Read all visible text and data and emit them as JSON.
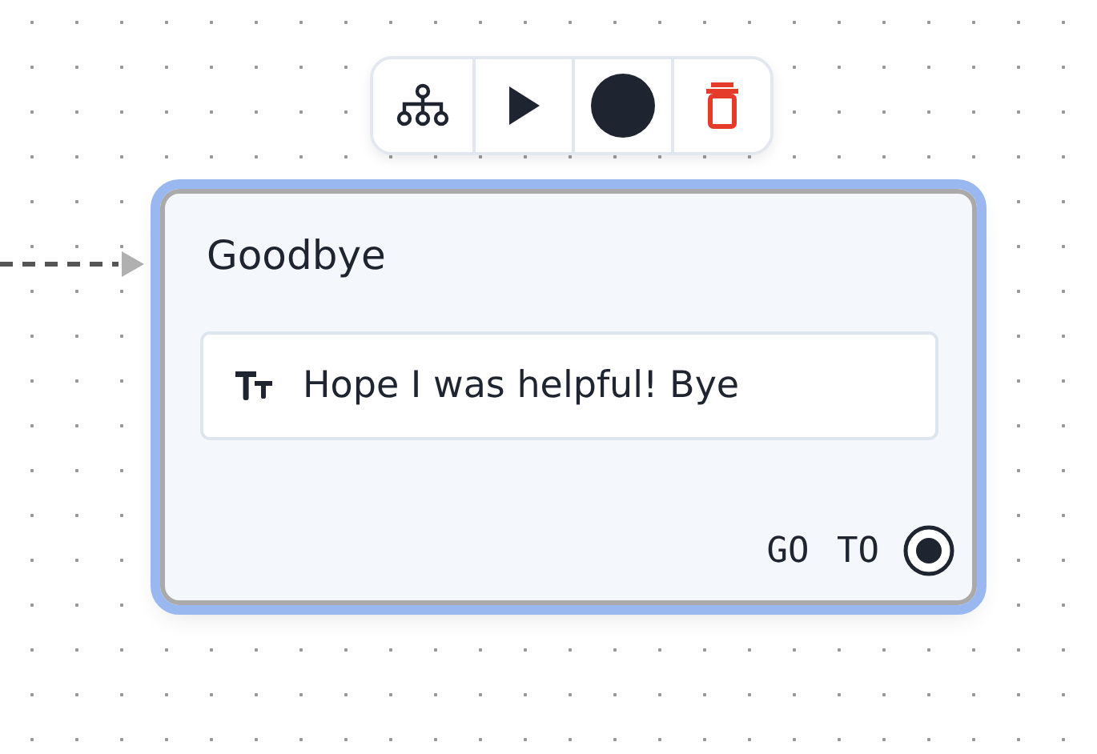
{
  "toolbar": {
    "buttons": [
      {
        "kind": "tree"
      },
      {
        "kind": "play"
      },
      {
        "kind": "record"
      },
      {
        "kind": "delete"
      }
    ]
  },
  "node": {
    "title": "Goodbye",
    "selected": true,
    "message": "Hope I was helpful! Bye",
    "footer": "GO TO"
  }
}
